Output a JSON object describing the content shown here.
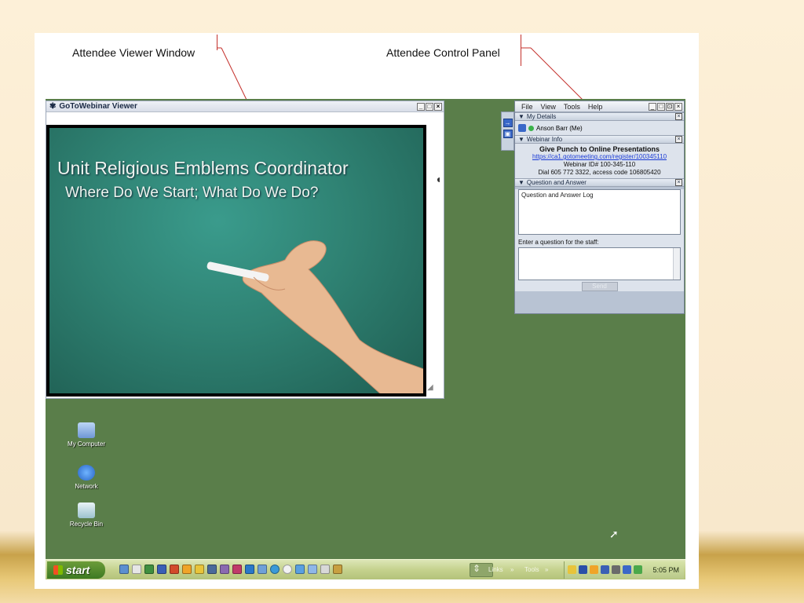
{
  "callouts": {
    "viewer_label": "Attendee Viewer Window",
    "panel_label": "Attendee Control Panel"
  },
  "viewer": {
    "title": "GoToWebinar Viewer",
    "icon": "gotowebinar-icon",
    "slide": {
      "title_line1": "Unit Religious Emblems Coordinator",
      "title_line2": "Where Do We Start; What Do We Do?"
    }
  },
  "panel": {
    "menu": [
      "File",
      "View",
      "Tools",
      "Help"
    ],
    "my_details": {
      "header": "My Details",
      "attendee": "Anson Barr (Me)"
    },
    "webinar_info": {
      "header": "Webinar Info",
      "title": "Give Punch to Online Presentations",
      "link": "https://ca1.gotomeeting.com/register/100345110",
      "webinar_id": "Webinar ID# 100-345-110",
      "dial": "Dial 605 772 3322, access code 106805420"
    },
    "qa": {
      "header": "Question and Answer",
      "log_label": "Question and Answer Log",
      "input_label": "Enter a question for the staff:",
      "send_label": "Send"
    }
  },
  "desktop_icons": [
    {
      "label": "My Computer",
      "icon": "my-computer-icon"
    },
    {
      "label": "Network",
      "icon": "network-icon"
    },
    {
      "label": "Recycle Bin",
      "icon": "recycle-bin-icon"
    }
  ],
  "taskbar": {
    "start_label": "start",
    "links_label": "Links",
    "tools_label": "Tools",
    "clock": "5:05 PM"
  },
  "colors": {
    "desktop": "#5a7e4a",
    "chalkboard": "#2f8273",
    "taskbar": "#c5d28e",
    "link": "#1a3bd6"
  }
}
